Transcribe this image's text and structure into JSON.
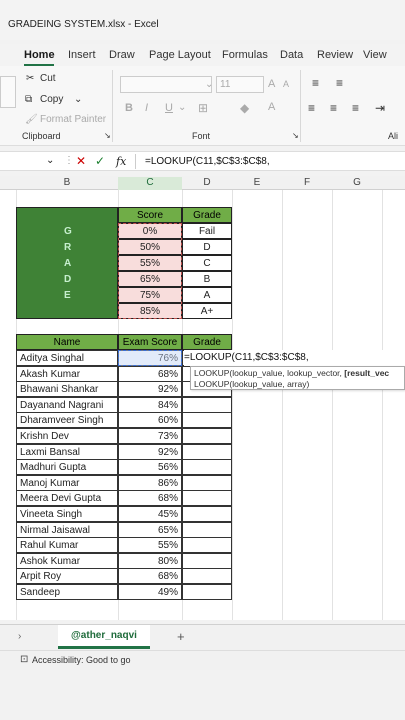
{
  "window": {
    "title": "GRADEING SYSTEM.xlsx  -  Excel"
  },
  "tabs": [
    "Home",
    "Insert",
    "Draw",
    "Page Layout",
    "Formulas",
    "Data",
    "Review",
    "View"
  ],
  "ribbon": {
    "cut": "Cut",
    "copy": "Copy",
    "format_painter": "Format Painter",
    "clipboard_group": "Clipboard",
    "font_group": "Font",
    "alignment_group": "Ali",
    "font_size": "11",
    "bold": "B",
    "italic": "I",
    "underline": "U"
  },
  "formula_bar": {
    "fx": "fx",
    "formula": "=LOOKUP(C11,$C$3:$C$8,"
  },
  "columns": [
    "B",
    "C",
    "D",
    "E",
    "F",
    "G"
  ],
  "grade_table": {
    "headers": [
      "Score",
      "Grade"
    ],
    "letters": [
      "G",
      "R",
      "A",
      "D",
      "E"
    ],
    "rows": [
      {
        "score": "0%",
        "grade": "Fail"
      },
      {
        "score": "50%",
        "grade": "D"
      },
      {
        "score": "55%",
        "grade": "C"
      },
      {
        "score": "65%",
        "grade": "B"
      },
      {
        "score": "75%",
        "grade": "A"
      },
      {
        "score": "85%",
        "grade": "A+"
      }
    ]
  },
  "student_table": {
    "headers": [
      "Name",
      "Exam Score",
      "Grade"
    ],
    "rows": [
      {
        "name": "Aditya Singhal",
        "score": "76%"
      },
      {
        "name": "Akash Kumar",
        "score": "68%"
      },
      {
        "name": "Bhawani Shankar",
        "score": "92%"
      },
      {
        "name": "Dayanand Nagrani",
        "score": "84%"
      },
      {
        "name": "Dharamveer Singh",
        "score": "60%"
      },
      {
        "name": "Krishn Dev",
        "score": "73%"
      },
      {
        "name": "Laxmi Bansal",
        "score": "92%"
      },
      {
        "name": "Madhuri Gupta",
        "score": "56%"
      },
      {
        "name": "Manoj Kumar",
        "score": "86%"
      },
      {
        "name": "Meera Devi Gupta",
        "score": "68%"
      },
      {
        "name": "Vineeta Singh",
        "score": "45%"
      },
      {
        "name": "Nirmal Jaisawal",
        "score": "65%"
      },
      {
        "name": "Rahul Kumar",
        "score": "55%"
      },
      {
        "name": "Ashok Kumar",
        "score": "80%"
      },
      {
        "name": "Arpit Roy",
        "score": "68%"
      },
      {
        "name": "Sandeep",
        "score": "49%"
      }
    ],
    "edit_cell": "=LOOKUP(C11,$C$3:$C$8,"
  },
  "tooltip": {
    "line1_prefix": "LOOKUP(lookup_value, lookup_vector, ",
    "line1_bold": "[result_vec",
    "line2": "LOOKUP(lookup_value, array)"
  },
  "sheet": {
    "name": "@ather_naqvi",
    "add": "+"
  },
  "status": {
    "text": "Accessibility: Good to go"
  },
  "colors": {
    "accent": "#217346",
    "header_green": "#70ad47",
    "dark_green": "#3f8236",
    "pink_fill": "#f8dddc"
  }
}
